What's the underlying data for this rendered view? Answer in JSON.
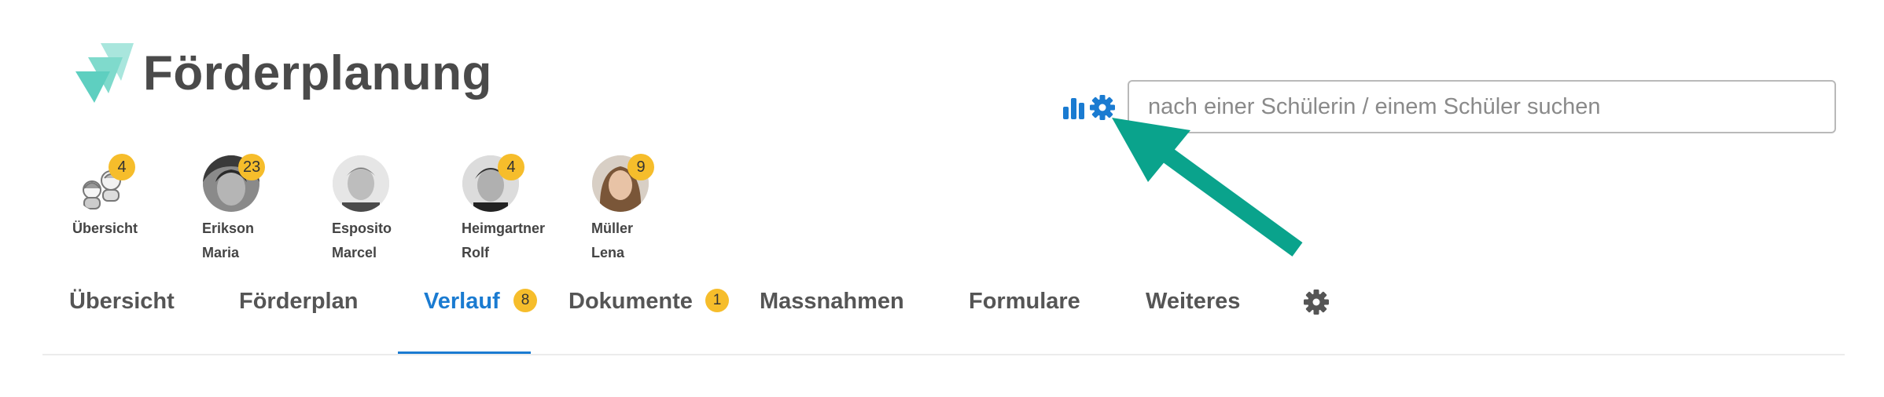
{
  "app": {
    "title": "Förderplanung"
  },
  "header": {
    "stats_icon": "bar-chart-icon",
    "settings_icon": "gear-icon",
    "search": {
      "placeholder": "nach einer Schülerin / einem Schüler suchen",
      "value": ""
    }
  },
  "students": [
    {
      "last": "Übersicht",
      "first": "",
      "count": "4",
      "avatar": "group-icon"
    },
    {
      "last": "Erikson",
      "first": "Maria",
      "count": "23",
      "avatar": "photo"
    },
    {
      "last": "Esposito",
      "first": "Marcel",
      "count": "",
      "avatar": "photo"
    },
    {
      "last": "Heimgartner",
      "first": "Rolf",
      "count": "4",
      "avatar": "photo"
    },
    {
      "last": "Müller",
      "first": "Lena",
      "count": "9",
      "avatar": "photo"
    }
  ],
  "tabs": [
    {
      "label": "Übersicht",
      "badge": ""
    },
    {
      "label": "Förderplan",
      "badge": ""
    },
    {
      "label": "Verlauf",
      "badge": "8",
      "active": true
    },
    {
      "label": "Dokumente",
      "badge": "1"
    },
    {
      "label": "Massnahmen",
      "badge": ""
    },
    {
      "label": "Formulare",
      "badge": ""
    },
    {
      "label": "Weiteres",
      "badge": ""
    }
  ],
  "colors": {
    "accent": "#1a7bd1",
    "badge": "#f6bd2b",
    "logo": "#5ecfc0",
    "arrow": "#0aa38c",
    "text": "#4a4a4a"
  }
}
